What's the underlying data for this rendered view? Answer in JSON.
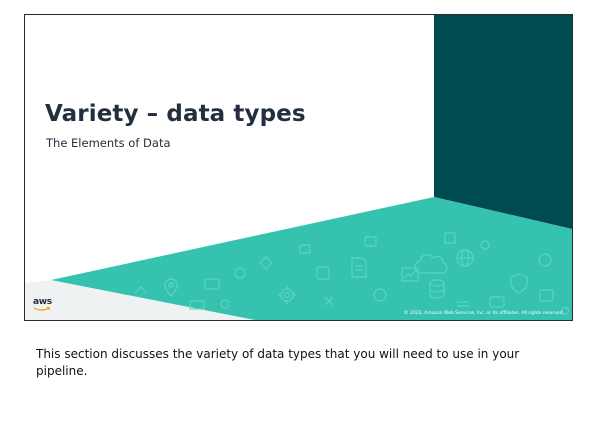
{
  "slide": {
    "title": "Variety – data types",
    "subtitle": "The Elements of Data",
    "logo": "aws",
    "copyright": "© 2022, Amazon Web Services, Inc. or its affiliates. All rights reserved.",
    "colors": {
      "dark_teal": "#004a51",
      "teal": "#35c3b0",
      "light_gray": "#eef2f2",
      "title": "#232f3e",
      "logo_smile": "#ff9900"
    },
    "icons": [
      "cloud-icon",
      "database-icon",
      "gear-icon",
      "chart-icon",
      "document-icon",
      "globe-icon",
      "map-pin-icon",
      "shield-icon"
    ]
  },
  "notes": {
    "text": "This section discusses the variety of data types that you will need to use in your pipeline."
  }
}
